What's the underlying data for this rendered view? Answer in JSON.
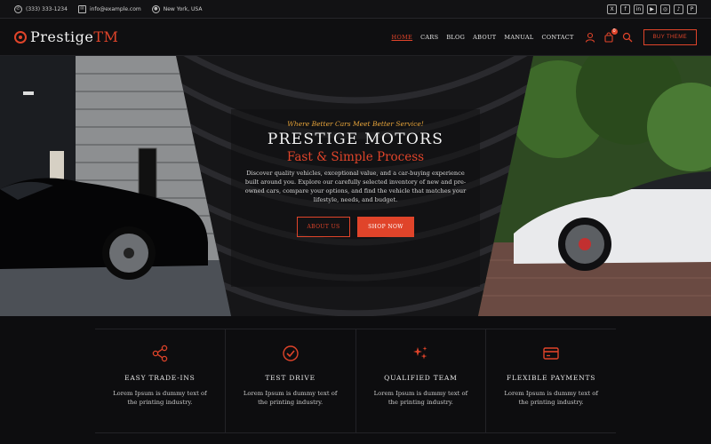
{
  "topbar": {
    "phone": "(333) 333-1234",
    "email": "info@example.com",
    "location": "New York, USA",
    "socials": [
      {
        "icon": "x-icon",
        "glyph": "X"
      },
      {
        "icon": "facebook-icon",
        "glyph": "f"
      },
      {
        "icon": "linkedin-icon",
        "glyph": "in"
      },
      {
        "icon": "youtube-icon",
        "glyph": "▶"
      },
      {
        "icon": "instagram-icon",
        "glyph": "◎"
      },
      {
        "icon": "tiktok-icon",
        "glyph": "♪"
      },
      {
        "icon": "pinterest-icon",
        "glyph": "P"
      }
    ]
  },
  "header": {
    "logo_main": "Prestige",
    "logo_tm": "TM",
    "nav": [
      "HOME",
      "CARS",
      "BLOG",
      "ABOUT",
      "MANUAL",
      "CONTACT"
    ],
    "active_nav": "HOME",
    "cart_count": "0",
    "buy_button": "BUY THEME"
  },
  "hero": {
    "tagline": "Where Better Cars Meet Better Service!",
    "title": "PRESTIGE MOTORS",
    "subtitle": "Fast & Simple Process",
    "description": "Discover quality vehicles, exceptional value, and a car-buying experience built around you. Explore our carefully selected inventory of new and pre-owned cars, compare your options, and find the vehicle that matches your lifestyle, needs, and budget.",
    "about_button": "ABOUT US",
    "shop_button": "SHOP NOW"
  },
  "features": [
    {
      "title": "EASY TRADE-INS",
      "desc": "Lorem Ipsum is dummy text of the printing industry.",
      "icon": "share-icon"
    },
    {
      "title": "TEST DRIVE",
      "desc": "Lorem Ipsum is dummy text of the printing industry.",
      "icon": "check-circle-icon"
    },
    {
      "title": "QUALIFIED TEAM",
      "desc": "Lorem Ipsum is dummy text of the printing industry.",
      "icon": "sparkle-icon"
    },
    {
      "title": "FLEXIBLE PAYMENTS",
      "desc": "Lorem Ipsum is dummy text of the printing industry.",
      "icon": "credit-card-icon"
    }
  ],
  "colors": {
    "accent": "#e0442a",
    "tagline": "#e7a43a",
    "background": "#0d0d0f"
  }
}
